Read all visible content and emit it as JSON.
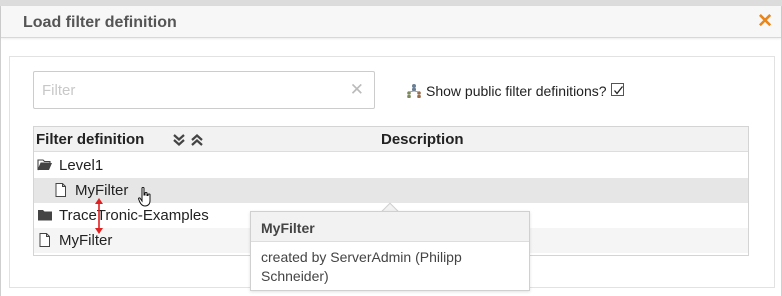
{
  "dialog": {
    "title": "Load filter definition",
    "close_glyph": "✕"
  },
  "filter": {
    "placeholder": "Filter",
    "value": "",
    "clear_glyph": "✕"
  },
  "public_toggle": {
    "label": "Show public filter definitions?",
    "checked": true,
    "icon": "people-network-icon"
  },
  "grid": {
    "columns": [
      "Filter definition",
      "Description"
    ],
    "expand_all_icon": "double-chevron-down-icon",
    "collapse_all_icon": "double-chevron-up-icon",
    "rows": [
      {
        "label": "Level1",
        "type": "folder",
        "icon": "folder-open-icon",
        "level": 0
      },
      {
        "label": "MyFilter",
        "type": "file",
        "icon": "document-icon",
        "level": 1,
        "hovered": true
      },
      {
        "label": "TraceTronic-Examples",
        "type": "folder",
        "icon": "folder-closed-icon",
        "level": 0
      },
      {
        "label": "MyFilter",
        "type": "file",
        "icon": "document-icon",
        "level": 0
      }
    ]
  },
  "tooltip": {
    "title": "MyFilter",
    "body": "created by ServerAdmin (Philipp Schneider)"
  },
  "colors": {
    "accent": "#e8851c",
    "header_bg": "#f2f2f2",
    "hover_row": "#e6e6e6",
    "drag_arrow": "#e02020"
  }
}
